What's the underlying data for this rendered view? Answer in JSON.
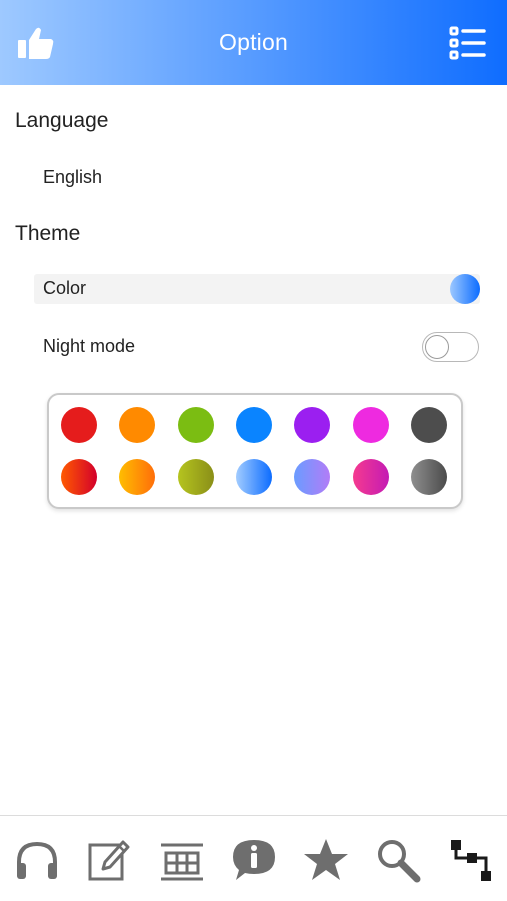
{
  "header": {
    "title": "Option",
    "like_icon": "thumbs-up-icon",
    "menu_icon": "list-menu-icon",
    "gradient": [
      "#9ec9ff",
      "#0f6dff"
    ]
  },
  "language": {
    "section_label": "Language",
    "value": "English"
  },
  "theme": {
    "section_label": "Theme",
    "color_label": "Color",
    "selected_color": [
      "#9cc8ff",
      "#0c6cff"
    ],
    "night_mode_label": "Night mode",
    "night_mode_on": false
  },
  "palette": {
    "solid": [
      "#e51c1c",
      "#ff8a00",
      "#7bbd12",
      "#0a84ff",
      "#9b1ff0",
      "#ee2ae0",
      "#4d4d4d"
    ],
    "gradients": [
      [
        "#ff5a00",
        "#d3002b"
      ],
      [
        "#ffbd00",
        "#ff6e0a"
      ],
      [
        "#b5c41f",
        "#8a8f18"
      ],
      [
        "#a2ccff",
        "#0c6cff"
      ],
      [
        "#6a9cff",
        "#b27cf7"
      ],
      [
        "#f53a8f",
        "#c41bb4"
      ],
      [
        "#8f8f8f",
        "#4b4b4b"
      ]
    ]
  },
  "bottom_nav": [
    {
      "icon": "headphones-icon"
    },
    {
      "icon": "edit-icon"
    },
    {
      "icon": "grid-icon"
    },
    {
      "icon": "info-icon"
    },
    {
      "icon": "star-icon"
    },
    {
      "icon": "search-icon"
    },
    {
      "icon": "flowchart-icon",
      "active": true
    }
  ]
}
